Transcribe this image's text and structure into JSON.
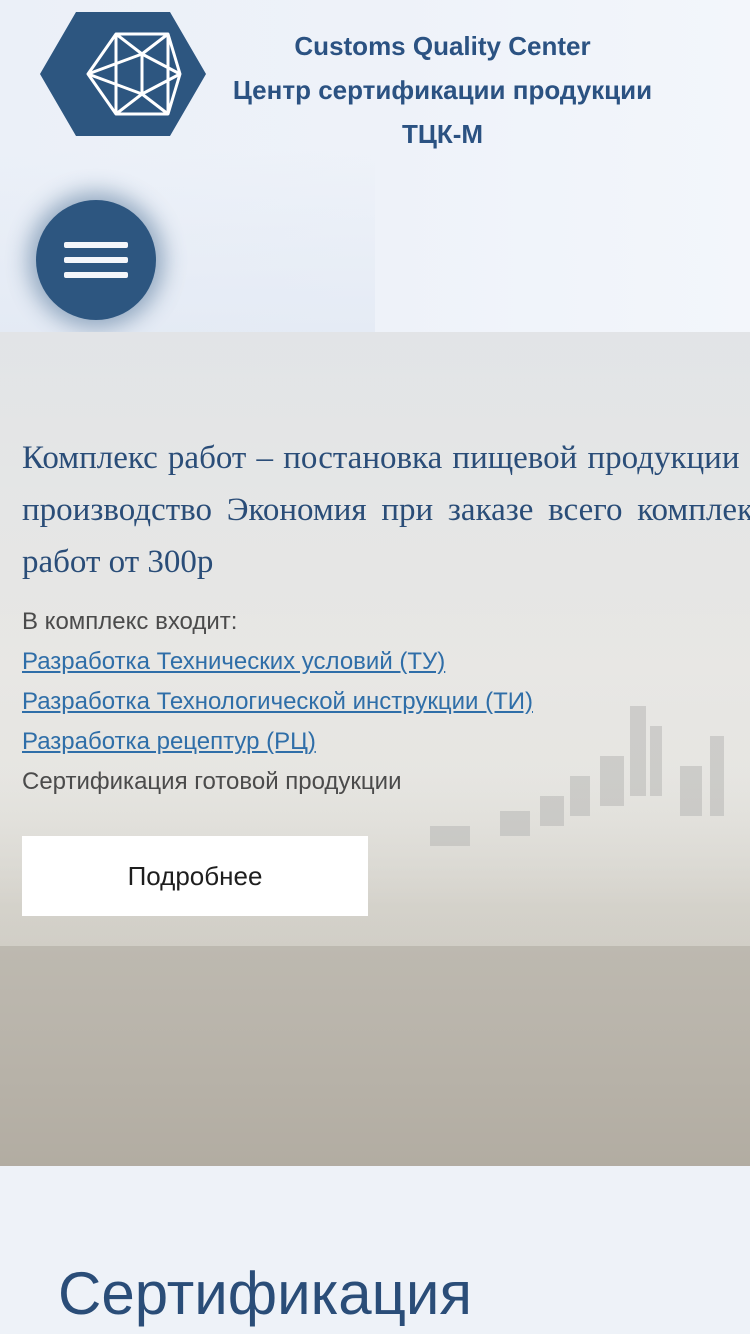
{
  "header": {
    "brand_line1": "Customs Quality Center",
    "brand_line2": "Центр сертификации продукции",
    "brand_line3": "ТЦК-М",
    "logo_color": "#2d5680",
    "menu_icon": "hamburger-icon"
  },
  "hero": {
    "title_line1": "Комплекс работ – постановка пищевой продукции на",
    "title_line2": "производство Экономия при заказе всего комплекса",
    "title_line3": "работ от 300р",
    "includes_label": "В комплекс входит:",
    "links": [
      "Разработка Технических условий (ТУ)",
      "Разработка Технологической инструкции (ТИ)",
      "Разработка рецептур (РЦ)"
    ],
    "last_item": "Сертификация готовой продукции",
    "more_button": "Подробнее"
  },
  "section": {
    "title": "Сертификация"
  },
  "colors": {
    "accent": "#2b5282",
    "link": "#2f6ea8",
    "menu_button": "#2d5680"
  }
}
